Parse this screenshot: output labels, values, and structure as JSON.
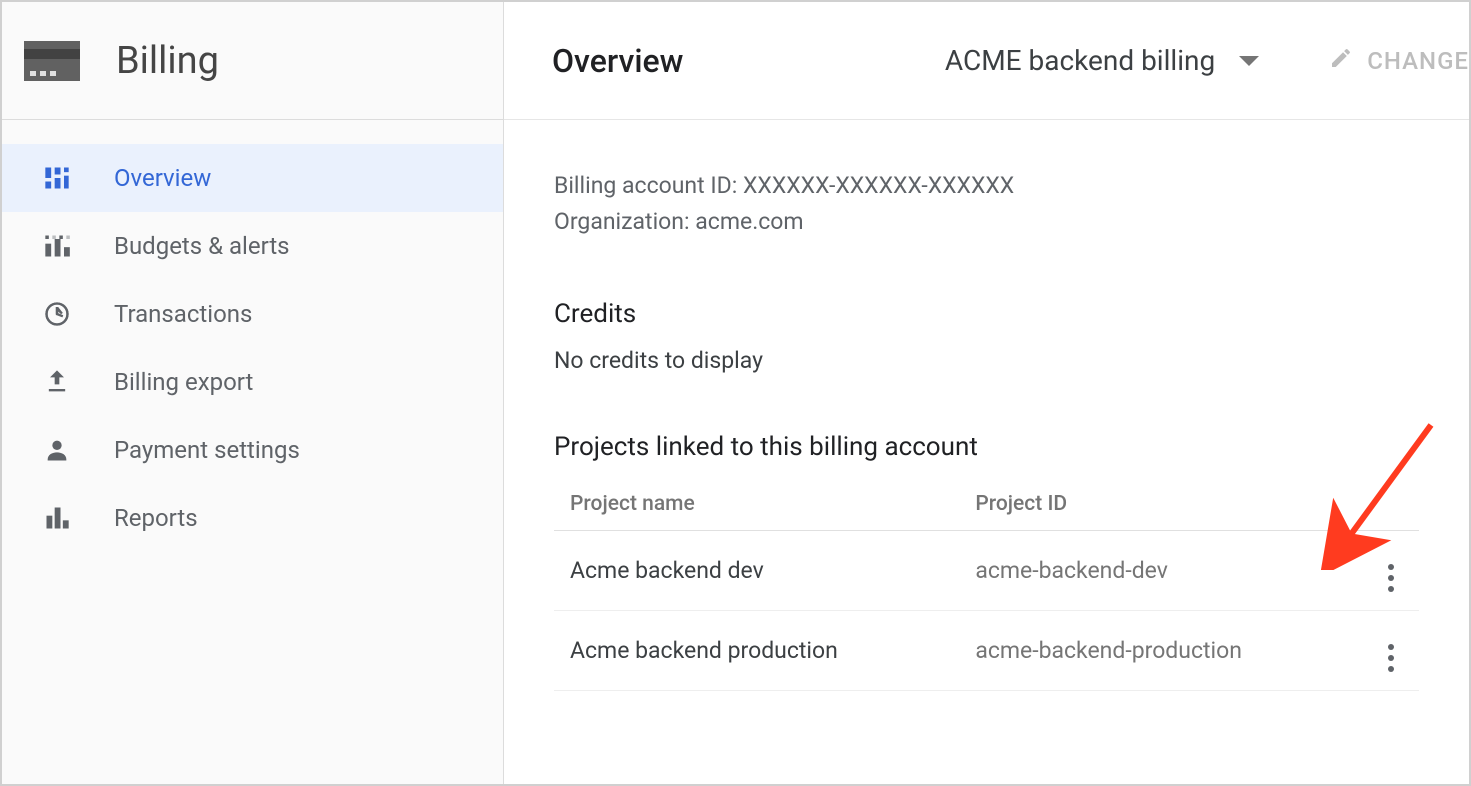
{
  "sidebar": {
    "title": "Billing",
    "items": [
      {
        "label": "Overview"
      },
      {
        "label": "Budgets & alerts"
      },
      {
        "label": "Transactions"
      },
      {
        "label": "Billing export"
      },
      {
        "label": "Payment settings"
      },
      {
        "label": "Reports"
      }
    ]
  },
  "header": {
    "page_title": "Overview",
    "account_name": "ACME backend billing",
    "change_label": "CHANGE"
  },
  "meta": {
    "account_id_label": "Billing account ID:",
    "account_id_value": "XXXXXX-XXXXXX-XXXXXX",
    "org_label": "Organization:",
    "org_value": "acme.com"
  },
  "credits": {
    "title": "Credits",
    "empty_text": "No credits to display"
  },
  "projects": {
    "title": "Projects linked to this billing account",
    "columns": {
      "name": "Project name",
      "id": "Project ID"
    },
    "rows": [
      {
        "name": "Acme backend dev",
        "id": "acme-backend-dev"
      },
      {
        "name": "Acme backend production",
        "id": "acme-backend-production"
      }
    ]
  }
}
